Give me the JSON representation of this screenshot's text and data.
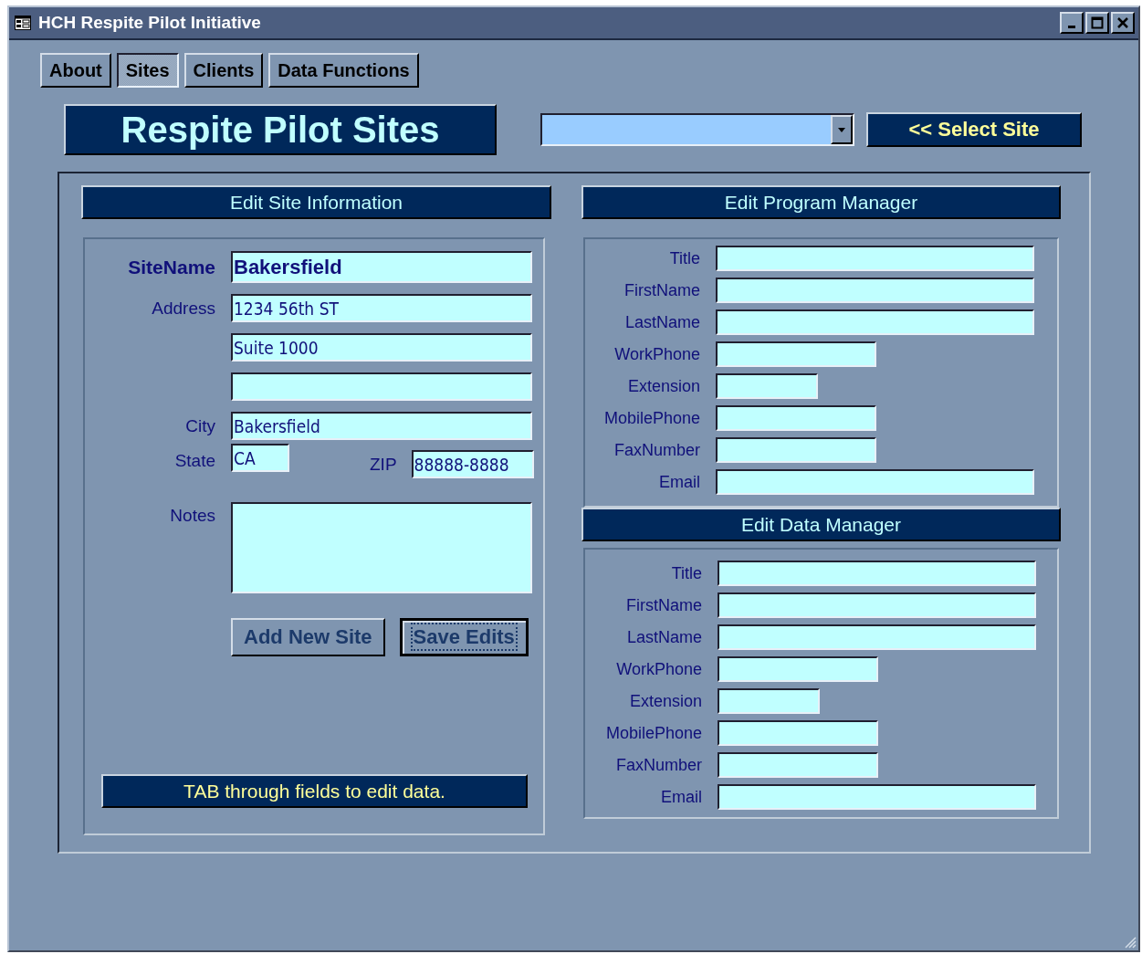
{
  "window": {
    "title": "HCH Respite Pilot Initiative"
  },
  "tabs": [
    {
      "label": "About",
      "selected": false
    },
    {
      "label": "Sites",
      "selected": true
    },
    {
      "label": "Clients",
      "selected": false
    },
    {
      "label": "Data Functions",
      "selected": false
    }
  ],
  "header": {
    "title": "Respite Pilot Sites",
    "select_button": "<< Select Site"
  },
  "site_section": {
    "title": "Edit Site Information",
    "rows": [
      [
        {
          "kind": "name",
          "label": "SiteName",
          "value": "Bakersfield"
        }
      ],
      [
        {
          "kind": "line",
          "label": "Address",
          "value": "1234 56th ST"
        }
      ],
      [
        {
          "kind": "line",
          "value": "Suite 1000"
        }
      ],
      [
        {
          "kind": "line"
        }
      ],
      [
        {
          "kind": "line",
          "label": "City",
          "value": "Bakersfield"
        }
      ],
      [
        {
          "kind": "short",
          "label": "State",
          "value": "CA"
        },
        {
          "kind": "zip",
          "label": "ZIP",
          "value": "88888-8888"
        }
      ],
      [
        {
          "kind": "notes",
          "label": "Notes"
        }
      ]
    ],
    "buttons": [
      {
        "label": "Add New Site",
        "focused": false
      },
      {
        "label": "Save Edits",
        "focused": true
      }
    ],
    "hint": "TAB through fields to edit data."
  },
  "managers": [
    {
      "title": "Edit Program Manager",
      "fields": [
        {
          "label": "Title",
          "kind": "long"
        },
        {
          "label": "FirstName",
          "kind": "long"
        },
        {
          "label": "LastName",
          "kind": "long"
        },
        {
          "label": "WorkPhone",
          "kind": "phone"
        },
        {
          "label": "Extension",
          "kind": "ext"
        },
        {
          "label": "MobilePhone",
          "kind": "phone"
        },
        {
          "label": "FaxNumber",
          "kind": "phone"
        },
        {
          "label": "Email",
          "kind": "long"
        }
      ]
    },
    {
      "title": "Edit Data Manager",
      "fields": [
        {
          "label": "Title",
          "kind": "long"
        },
        {
          "label": "FirstName",
          "kind": "long"
        },
        {
          "label": "LastName",
          "kind": "long"
        },
        {
          "label": "WorkPhone",
          "kind": "phone"
        },
        {
          "label": "Extension",
          "kind": "ext"
        },
        {
          "label": "MobilePhone",
          "kind": "phone"
        },
        {
          "label": "FaxNumber",
          "kind": "phone"
        },
        {
          "label": "Email",
          "kind": "long"
        }
      ]
    }
  ]
}
